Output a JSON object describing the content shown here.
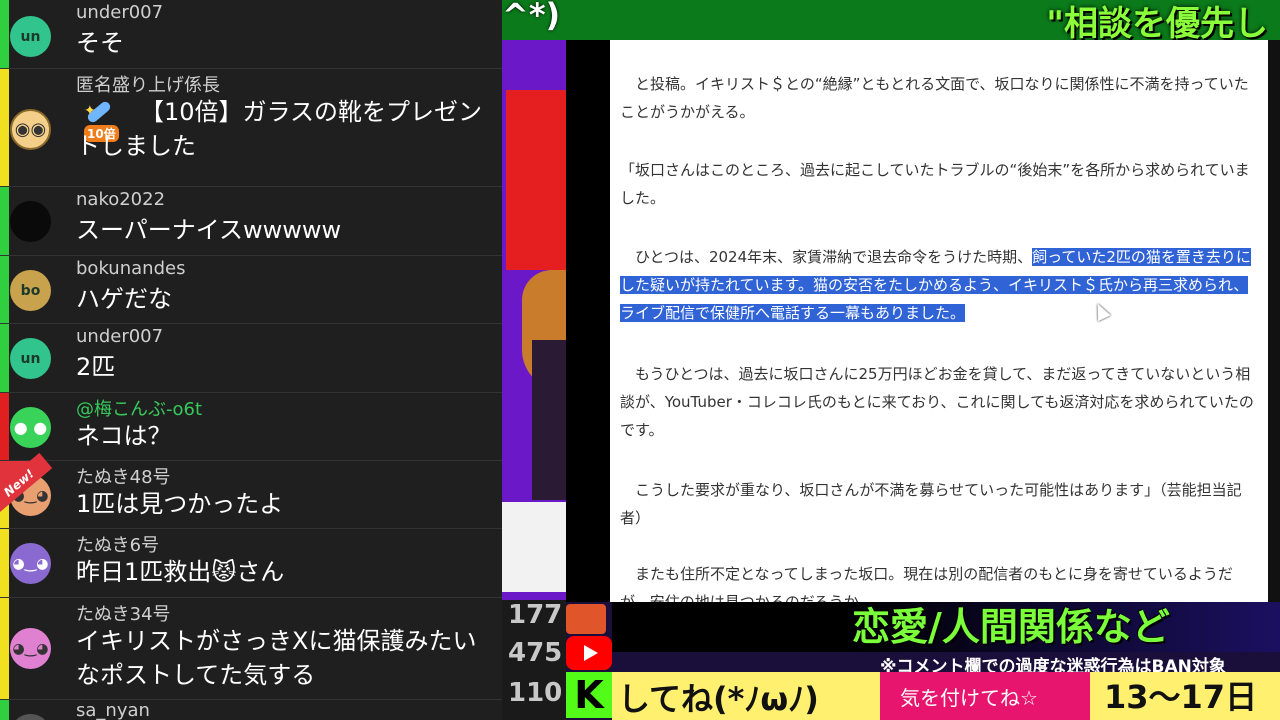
{
  "chat": {
    "messages": [
      {
        "author": "under007",
        "text": "そそ",
        "avatar": "un",
        "bar": "#2fcf3f",
        "avatar_bg": "#31c48d"
      },
      {
        "author": "匿名盛り上げ係長",
        "text": "【10倍】ガラスの靴をプレゼントしました",
        "avatar": "",
        "bar": "#f0e020",
        "avatar_bg": "#f3cf8a",
        "gift_label": "10倍"
      },
      {
        "author": "nako2022",
        "text": "スーパーナイスwwwww",
        "avatar": "",
        "bar": "#2fcf3f",
        "avatar_bg": "#0a0a0a"
      },
      {
        "author": "bokunandes",
        "text": "ハゲだな",
        "avatar": "bo",
        "bar": "#2fcf3f",
        "avatar_bg": "#c9a24d"
      },
      {
        "author": "under007",
        "text": "2匹",
        "avatar": "un",
        "bar": "#2fcf3f",
        "avatar_bg": "#31c48d"
      },
      {
        "author": "@梅こんぶ-o6t",
        "text": "ネコは？",
        "avatar": "",
        "bar": "#e02020",
        "avatar_bg": "#3ad35a"
      },
      {
        "author": "たぬき48号",
        "text": "1匹は見つかったよ",
        "avatar": "",
        "bar": "#f0e020",
        "avatar_bg": "#e8a070",
        "badge": "New!"
      },
      {
        "author": "たぬき6号",
        "text": "昨日1匹救出😾さん",
        "avatar": "",
        "bar": "#f0e020",
        "avatar_bg": "#8a6ad0"
      },
      {
        "author": "たぬき34号",
        "text": "イキリストがさっきXに猫保護みたいなポストしてた気する",
        "avatar": "",
        "bar": "#f0e020",
        "avatar_bg": "#e080d0"
      },
      {
        "author": "sa_nyan",
        "text": "",
        "avatar": "",
        "bar": "#2fcf3f",
        "avatar_bg": "#555555"
      }
    ]
  },
  "stream": {
    "top_left": "^*)",
    "top_right": "\"相談を優先し",
    "numbers": [
      "177",
      "475",
      "110"
    ],
    "ticker_top": "恋愛/人間関係など",
    "notice": "※コメント欄での過度な迷惑行為はBAN対象",
    "ticker_left": "してね(*ﾉωﾉ)",
    "ticker_mid": "気を付けてね☆",
    "ticker_right": "13～17日",
    "k_icon": "K"
  },
  "article": {
    "p1": "と投稿。イキリスト＄との“絶縁”ともとれる文面で、坂口なりに関係性に不満を持っていたことがうかがえる。",
    "p2": "「坂口さんはこのところ、過去に起こしていたトラブルの“後始末”を各所から求められていました。",
    "p3_plain": "ひとつは、2024年末、家賃滞納で退去命令をうけた時期、",
    "p3_highlight": "飼っていた2匹の猫を置き去りにした疑いが持たれています。猫の安否をたしかめるよう、イキリスト＄氏から再三求められ、ライブ配信で保健所へ電話する一幕もありました。",
    "p4": "もうひとつは、過去に坂口さんに25万円ほどお金を貸して、まだ返ってきていないという相談が、YouTuber・コレコレ氏のもとに来ており、これに関しても返済対応を求められていたのです。",
    "p5": "こうした要求が重なり、坂口さんが不満を募らせていった可能性はあります」（芸能担当記者）",
    "p6": "またも住所不定となってしまった坂口。現在は別の配信者のもとに身を寄せているようだが、安住の地は見つかるのだろうか。"
  }
}
